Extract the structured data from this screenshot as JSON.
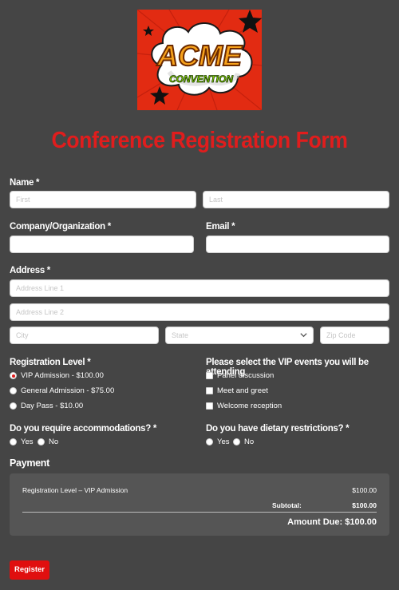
{
  "logo": {
    "word": "ACME",
    "sub": "CONVENTION",
    "background": "#e22b12"
  },
  "form_title": "Conference Registration Form",
  "name": {
    "label": "Name *",
    "first_placeholder": "First",
    "last_placeholder": "Last"
  },
  "company": {
    "label": "Company/Organization *"
  },
  "email": {
    "label": "Email *"
  },
  "address": {
    "label": "Address *",
    "line1_placeholder": "Address Line 1",
    "line2_placeholder": "Address Line 2",
    "city_placeholder": "City",
    "state_placeholder": "State",
    "zip_placeholder": "Zip Code"
  },
  "registration_level": {
    "label": "Registration Level *",
    "options": [
      {
        "label": "VIP Admission - $100.00",
        "checked": true
      },
      {
        "label": "General Admission - $75.00",
        "checked": false
      },
      {
        "label": "Day Pass - $10.00",
        "checked": false
      }
    ]
  },
  "vip_events": {
    "label": "Please select the VIP events you will be attending",
    "options": [
      {
        "label": "Panel discussion"
      },
      {
        "label": "Meet and greet"
      },
      {
        "label": "Welcome reception"
      }
    ]
  },
  "accommodations": {
    "label": "Do you require accommodations? *",
    "yes": "Yes",
    "no": "No"
  },
  "dietary": {
    "label": "Do you have dietary restrictions? *",
    "yes": "Yes",
    "no": "No"
  },
  "payment": {
    "title": "Payment",
    "item_label": "Registration Level – VIP Admission",
    "item_price": "$100.00",
    "subtotal_label": "Subtotal:",
    "subtotal_value": "$100.00",
    "amount_due": "Amount Due: $100.00"
  },
  "register_label": "Register",
  "colors": {
    "page_bg": "#454545",
    "accent": "#e01d1d",
    "payment_box": "#555555"
  }
}
